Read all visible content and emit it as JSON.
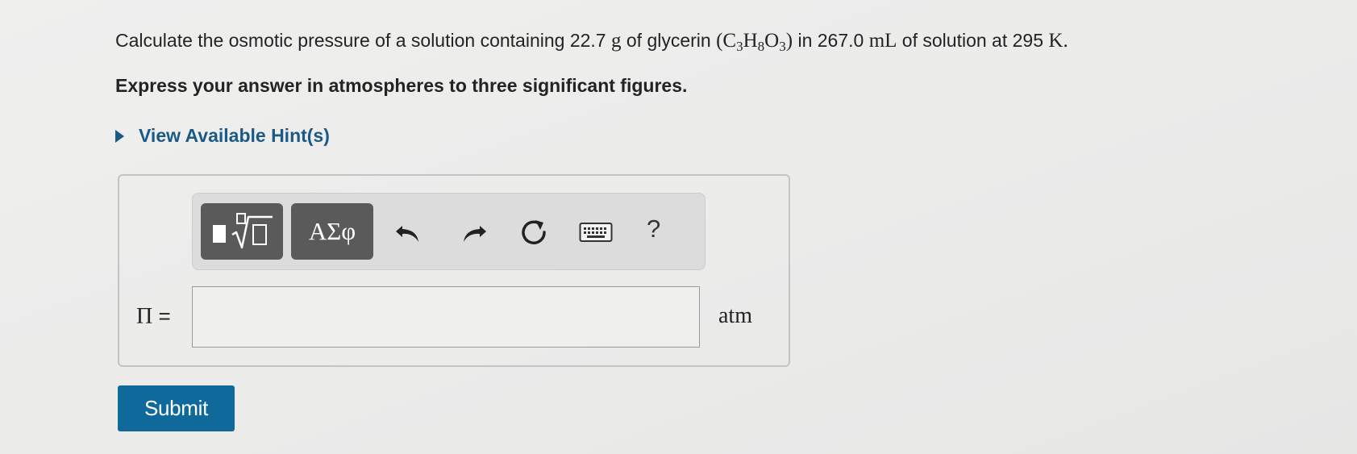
{
  "question": {
    "prefix": "Calculate the osmotic pressure of a solution containing 22.7 ",
    "mass_unit": "g",
    "middle": " of glycerin ",
    "formula": {
      "open": "(",
      "el1": "C",
      "sub1": "3",
      "el2": "H",
      "sub2": "8",
      "el3": "O",
      "sub3": "3",
      "close": ")"
    },
    "volume_text": " in 267.0 ",
    "volume_unit": "mL",
    "temp_text": " of solution at 295 ",
    "temp_unit": "K",
    "end": "."
  },
  "instruction": "Express your answer in atmospheres to three significant figures.",
  "hint": {
    "label": "View Available Hint(s)"
  },
  "toolbar": {
    "templates_icon": "fraction-root-template-icon",
    "symbols_label": "ΑΣφ",
    "undo_icon": "undo-icon",
    "redo_icon": "redo-icon",
    "reset_icon": "reset-icon",
    "keyboard_icon": "keyboard-icon",
    "help_label": "?"
  },
  "answer": {
    "variable": "Π",
    "equals": " =",
    "value": "",
    "unit": "atm"
  },
  "submit_label": "Submit",
  "colors": {
    "link": "#1c5a86",
    "toolbar_button": "#5a5a5a",
    "submit": "#0f6a9b"
  }
}
